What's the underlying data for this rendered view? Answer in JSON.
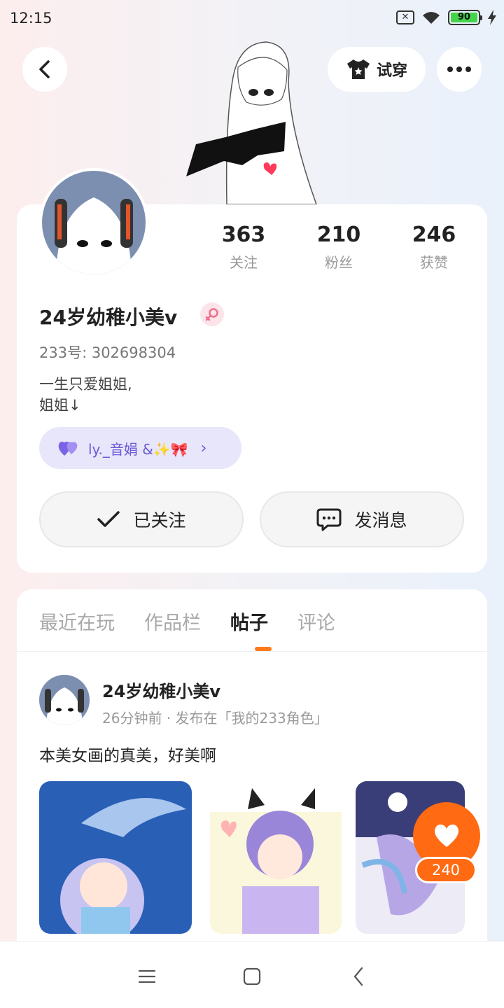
{
  "status_bar": {
    "time": "12:15",
    "battery": "90"
  },
  "header": {
    "tryon_label": "试穿"
  },
  "profile": {
    "username": "24岁幼稚小美v",
    "user_id": "233号: 302698304",
    "bio_line1": "一生只爱姐姐,",
    "bio_line2": "姐姐↓",
    "cp_label": "ly._音娟 &✨🎀",
    "stats": [
      {
        "value": "363",
        "label": "关注"
      },
      {
        "value": "210",
        "label": "粉丝"
      },
      {
        "value": "246",
        "label": "获赞"
      }
    ],
    "follow_label": "已关注",
    "message_label": "发消息"
  },
  "tabs": [
    {
      "label": "最近在玩",
      "active": false
    },
    {
      "label": "作品栏",
      "active": false
    },
    {
      "label": "帖子",
      "active": true
    },
    {
      "label": "评论",
      "active": false
    }
  ],
  "post": {
    "author": "24岁幼稚小美v",
    "meta": "26分钟前 · 发布在「我的233角色」",
    "text": "本美女画的真美，好美啊",
    "likes": "240"
  },
  "colors": {
    "accent": "#ff6a12",
    "cp_bg": "#e8e6fb",
    "cp_text": "#6a5bd6"
  }
}
